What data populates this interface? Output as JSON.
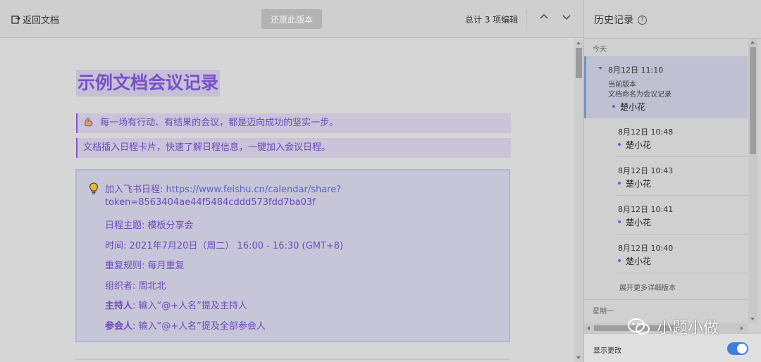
{
  "toolbar": {
    "back_label": "返回文档",
    "restore_label": "还原此版本",
    "edit_count": "总计 3 项编辑"
  },
  "document": {
    "title": "示例文档会议记录",
    "callout_1": "每一场有行动、有结果的会议，都是迈向成功的坚实一步。",
    "callout_2": "文档插入日程卡片，快速了解日程信息，一键加入会议日程。",
    "card": {
      "link_prefix": "加入飞书日程: ",
      "link_line_1": "https://www.feishu.cn/calendar/share?",
      "link_line_2": "token=8563404ae44f5484cddd573fdd7ba03f",
      "topic": "日程主题: 模板分享会",
      "time": "时间: 2021年7月20日（周二） 16:00 - 16:30 (GMT+8)",
      "repeat": "重复规则: 每月重复",
      "organizer": "组织者: 周北北",
      "host_label": "主持人",
      "host_value": ": 输入“@+人名”提及主持人",
      "attendee_label": "参会人",
      "attendee_value": ": 输入“@+人名”提及全部参会人"
    }
  },
  "history": {
    "title": "历史记录",
    "today_label": "今天",
    "versions": [
      {
        "time": "8月12日 11:10",
        "sub1": "当前版本",
        "sub2": "文档命名为会议记录",
        "author": "楚小花"
      },
      {
        "time": "8月12日 10:48",
        "author": "楚小花"
      },
      {
        "time": "8月12日 10:43",
        "author": "楚小花"
      },
      {
        "time": "8月12日 10:41",
        "author": "楚小花"
      },
      {
        "time": "8月12日 10:40",
        "author": "楚小花"
      }
    ],
    "expand_more": "展开更多详细版本",
    "week_label": "星期一",
    "show_changes_label": "显示更改",
    "show_changes_on": true
  },
  "watermark": {
    "text": "小题小做"
  },
  "colors": {
    "accent_purple": "#7a4fc8",
    "toggle_blue": "#3d7fe0"
  }
}
